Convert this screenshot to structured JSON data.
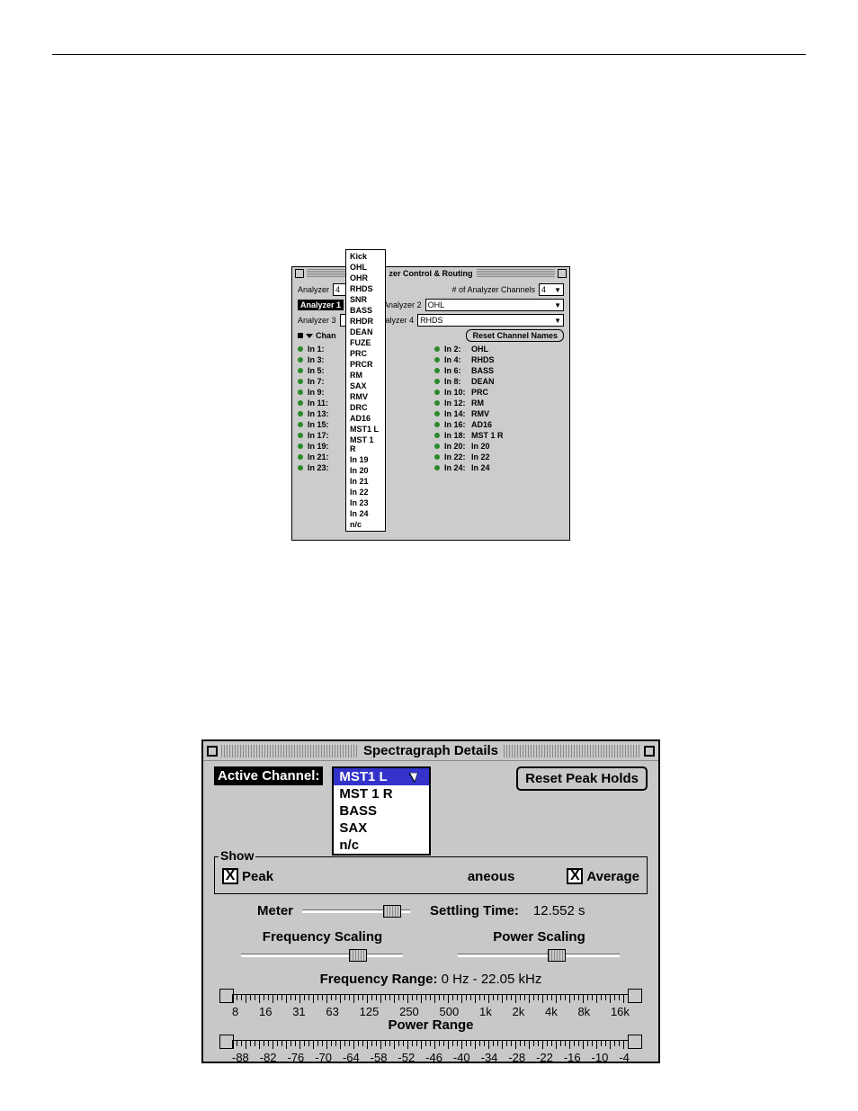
{
  "top": {
    "title": "zer Control & Routing",
    "analyzer_label": "Analyzer",
    "num_channels_label": "# of Analyzer Channels",
    "num_channels_value": "4",
    "rows": [
      {
        "l": "Analyzer 1",
        "lv": "",
        "r": "Analyzer 2",
        "rv": "OHL",
        "sel_left": true
      },
      {
        "l": "Analyzer 3",
        "lv": "",
        "r": "Analyzer 4",
        "rv": "RHDS"
      }
    ],
    "reset_btn": "Reset Channel Names",
    "chan_label": "Chan",
    "dropdown": [
      "Kick",
      "OHL",
      "OHR",
      "RHDS",
      "SNR",
      "BASS",
      "RHDR",
      "DEAN",
      "FUZE",
      "PRC",
      "PRCR",
      "RM",
      "SAX",
      "RMV",
      "DRC",
      "AD16",
      "MST1 L",
      "MST 1 R",
      "In 19",
      "In 20",
      "In 21",
      "In 22",
      "In 23",
      "In 24",
      "n/c"
    ],
    "ins_left": [
      {
        "n": "In 1:",
        "v": ""
      },
      {
        "n": "In 3:",
        "v": ""
      },
      {
        "n": "In 5:",
        "v": ""
      },
      {
        "n": "In 7:",
        "v": ""
      },
      {
        "n": "In 9:",
        "v": ""
      },
      {
        "n": "In 11:",
        "v": ""
      },
      {
        "n": "In 13:",
        "v": ""
      },
      {
        "n": "In 15:",
        "v": ""
      },
      {
        "n": "In 17:",
        "v": ""
      },
      {
        "n": "In 19:",
        "v": ""
      },
      {
        "n": "In 21:",
        "v": ""
      },
      {
        "n": "In 23:",
        "v": ""
      }
    ],
    "ins_right": [
      {
        "n": "In 2:",
        "v": "OHL"
      },
      {
        "n": "In 4:",
        "v": "RHDS"
      },
      {
        "n": "In 6:",
        "v": "BASS"
      },
      {
        "n": "In 8:",
        "v": "DEAN"
      },
      {
        "n": "In 10:",
        "v": "PRC"
      },
      {
        "n": "In 12:",
        "v": "RM"
      },
      {
        "n": "In 14:",
        "v": "RMV"
      },
      {
        "n": "In 16:",
        "v": "AD16"
      },
      {
        "n": "In 18:",
        "v": "MST 1 R"
      },
      {
        "n": "In 20:",
        "v": "In 20"
      },
      {
        "n": "In 22:",
        "v": "In 22"
      },
      {
        "n": "In 24:",
        "v": "In 24"
      }
    ]
  },
  "bot": {
    "title": "Spectragraph Details",
    "active_channel_label": "Active Channel:",
    "ac_options": [
      "MST1 L",
      "MST 1 R",
      "BASS",
      "SAX",
      "n/c"
    ],
    "ac_selected": "MST1 L",
    "reset_peak": "Reset Peak Holds",
    "show_label": "Show",
    "peak": "Peak",
    "instantaneous_frag": "aneous",
    "average": "Average",
    "meter_label": "Meter",
    "settling_label": "Settling Time:",
    "settling_value": "12.552 s",
    "freq_scaling": "Frequency Scaling",
    "power_scaling": "Power Scaling",
    "freq_range_label": "Frequency Range:",
    "freq_range_value": "0 Hz - 22.05 kHz",
    "freq_ticks": [
      "8",
      "16",
      "31",
      "63",
      "125",
      "250",
      "500",
      "1k",
      "2k",
      "4k",
      "8k",
      "16k"
    ],
    "power_range_label": "Power Range",
    "power_ticks": [
      "-88",
      "-82",
      "-76",
      "-70",
      "-64",
      "-58",
      "-52",
      "-46",
      "-40",
      "-34",
      "-28",
      "-22",
      "-16",
      "-10",
      "-4"
    ]
  }
}
